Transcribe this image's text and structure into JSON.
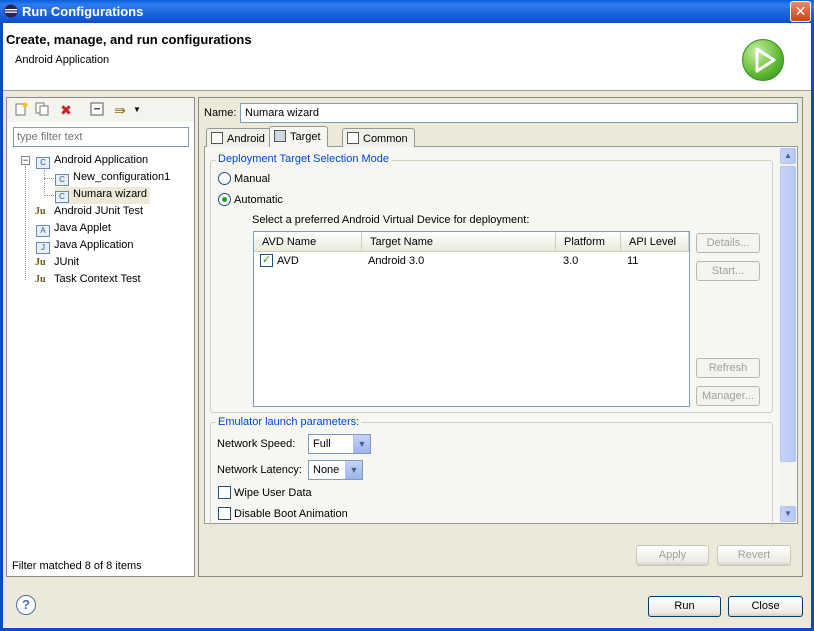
{
  "window": {
    "title": "Run Configurations",
    "close_glyph": "✕"
  },
  "header": {
    "title": "Create, manage, and run configurations",
    "subtitle": "Android Application",
    "run_icon": "run-icon"
  },
  "left": {
    "filter_placeholder": "type filter text",
    "toolbar": [
      "new-config-icon",
      "duplicate-icon",
      "delete-icon",
      "collapse-all-icon",
      "filter-icon"
    ],
    "tree": [
      {
        "label": "Android Application",
        "expanded": true
      },
      {
        "label": "New_configuration1"
      },
      {
        "label": "Numara wizard",
        "selected": true
      },
      {
        "label": "Android JUnit Test"
      },
      {
        "label": "Java Applet"
      },
      {
        "label": "Java Application"
      },
      {
        "label": "JUnit"
      },
      {
        "label": "Task Context Test"
      }
    ],
    "status": "Filter matched 8 of 8 items"
  },
  "config": {
    "name_label": "Name:",
    "name_value": "Numara wizard",
    "tabs": [
      {
        "label": "Android"
      },
      {
        "label": "Target",
        "active": true
      },
      {
        "label": "Common"
      }
    ],
    "deployment": {
      "title": "Deployment Target Selection Mode",
      "manual_label": "Manual",
      "automatic_label": "Automatic",
      "prompt": "Select a preferred Android Virtual Device for deployment:",
      "columns": [
        "AVD Name",
        "Target Name",
        "Platform",
        "API Level"
      ],
      "rows": [
        {
          "checked": true,
          "avd": "AVD",
          "target": "Android 3.0",
          "platform": "3.0",
          "api": "11"
        }
      ],
      "buttons": {
        "details": "Details...",
        "start": "Start...",
        "refresh": "Refresh",
        "manager": "Manager..."
      }
    },
    "emulator": {
      "title": "Emulator launch parameters:",
      "network_speed_label": "Network Speed:",
      "network_speed_value": "Full",
      "network_latency_label": "Network Latency:",
      "network_latency_value": "None",
      "wipe_label": "Wipe User Data",
      "disable_boot_label": "Disable Boot Animation"
    },
    "apply_label": "Apply",
    "revert_label": "Revert"
  },
  "footer": {
    "help_glyph": "?",
    "run_label": "Run",
    "close_label": "Close"
  },
  "colors": {
    "titlebar": "#0a5fd8",
    "group_title": "#0046d5",
    "check": "#21a121"
  }
}
